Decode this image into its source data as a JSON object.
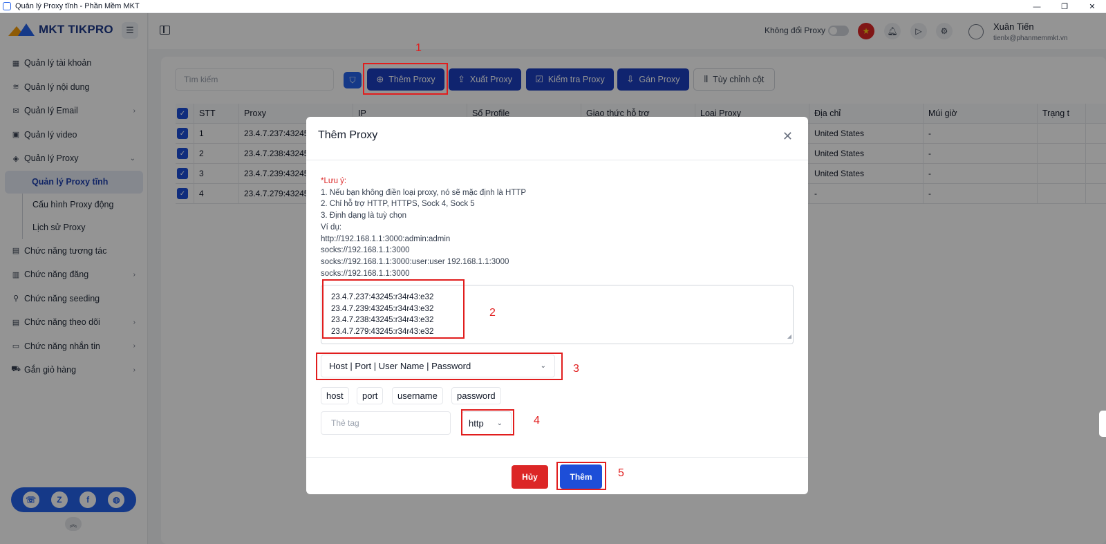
{
  "window": {
    "title": "Quản lý Proxy tĩnh - Phần Mềm MKT",
    "controls": [
      "—",
      "❐",
      "✕"
    ]
  },
  "sidebar": {
    "logo_text": "MKT TIKPRO",
    "items": [
      {
        "label": "Quản lý tài khoản",
        "icon": "grid-icon",
        "glyph": "▦",
        "chevron": ""
      },
      {
        "label": "Quản lý nội dung",
        "icon": "content-icon",
        "glyph": "≋",
        "chevron": ""
      },
      {
        "label": "Quản lý Email",
        "icon": "mail-icon",
        "glyph": "✉",
        "chevron": "›"
      },
      {
        "label": "Quản lý video",
        "icon": "video-icon",
        "glyph": "▣",
        "chevron": ""
      },
      {
        "label": "Quản lý Proxy",
        "icon": "layers-icon",
        "glyph": "◈",
        "chevron": "⌄"
      }
    ],
    "proxy_subitems": [
      "Quản lý Proxy tĩnh",
      "Cấu hình Proxy động",
      "Lịch sử Proxy"
    ],
    "items_after": [
      {
        "label": "Chức năng tương tác",
        "icon": "interact-icon",
        "glyph": "▤",
        "chevron": ""
      },
      {
        "label": "Chức năng đăng",
        "icon": "post-icon",
        "glyph": "▥",
        "chevron": "›"
      },
      {
        "label": "Chức năng seeding",
        "icon": "seeding-icon",
        "glyph": "⚲",
        "chevron": ""
      },
      {
        "label": "Chức năng theo dõi",
        "icon": "follow-icon",
        "glyph": "▤",
        "chevron": "›"
      },
      {
        "label": "Chức năng nhắn tin",
        "icon": "chat-icon",
        "glyph": "▭",
        "chevron": "›"
      },
      {
        "label": "Gắn giỏ hàng",
        "icon": "cart-icon",
        "glyph": "⛟",
        "chevron": "›"
      }
    ]
  },
  "topbar": {
    "no_change_proxy_label": "Không đổi Proxy",
    "user_name": "Xuân Tiến",
    "user_email": "tienlx@phanmemmkt.vn"
  },
  "toolbar": {
    "search_placeholder": "Tìm kiếm",
    "add_proxy": "Thêm Proxy",
    "export_proxy": "Xuất Proxy",
    "check_proxy": "Kiểm tra Proxy",
    "assign_proxy": "Gán Proxy",
    "customize_columns": "Tùy chỉnh cột"
  },
  "table": {
    "columns": [
      "STT",
      "Proxy",
      "IP",
      "Số Profile",
      "Giao thức hỗ trợ",
      "Loại Proxy",
      "Địa chỉ",
      "Múi giờ",
      "Trạng t"
    ],
    "rows": [
      {
        "stt": "1",
        "proxy": "23.4.7.237:43245",
        "address": "United States",
        "timezone": "-"
      },
      {
        "stt": "2",
        "proxy": "23.4.7.238:43245",
        "address": "United States",
        "timezone": "-"
      },
      {
        "stt": "3",
        "proxy": "23.4.7.239:43245",
        "address": "United States",
        "timezone": "-"
      },
      {
        "stt": "4",
        "proxy": "23.4.7.279:43245",
        "address": "-",
        "timezone": "-"
      }
    ]
  },
  "modal": {
    "title": "Thêm Proxy",
    "note_title": "*Lưu ý:",
    "note_lines": [
      "1. Nếu bạn không điền loại proxy, nó sẽ mặc định là HTTP",
      "2. Chỉ hỗ trợ HTTP, HTTPS, Sock 4, Sock 5",
      "3. Định dạng là tuỳ chọn",
      "Ví dụ:",
      "http://192.168.1.1:3000:admin:admin",
      "socks://192.168.1.1:3000",
      "socks://192.168.1.1:3000:user:user 192.168.1.1:3000",
      "socks://192.168.1.1:3000"
    ],
    "proxy_lines": [
      "23.4.7.237:43245:r34r43:e32",
      "23.4.7.239:43245:r34r43:e32",
      "23.4.7.238:43245:r34r43:e32",
      "23.4.7.279:43245:r34r43:e32"
    ],
    "format_value": "Host | Port | User Name | Password",
    "chips": [
      "host",
      "port",
      "username",
      "password"
    ],
    "tag_placeholder": "Thẻ tag",
    "type_value": "http",
    "cancel": "Hủy",
    "add": "Thêm"
  },
  "annotations": [
    "1",
    "2",
    "3",
    "4",
    "5"
  ],
  "colors": {
    "primary": "#1d3fbf",
    "danger": "#dc2626",
    "annotation": "#e11d1d"
  }
}
